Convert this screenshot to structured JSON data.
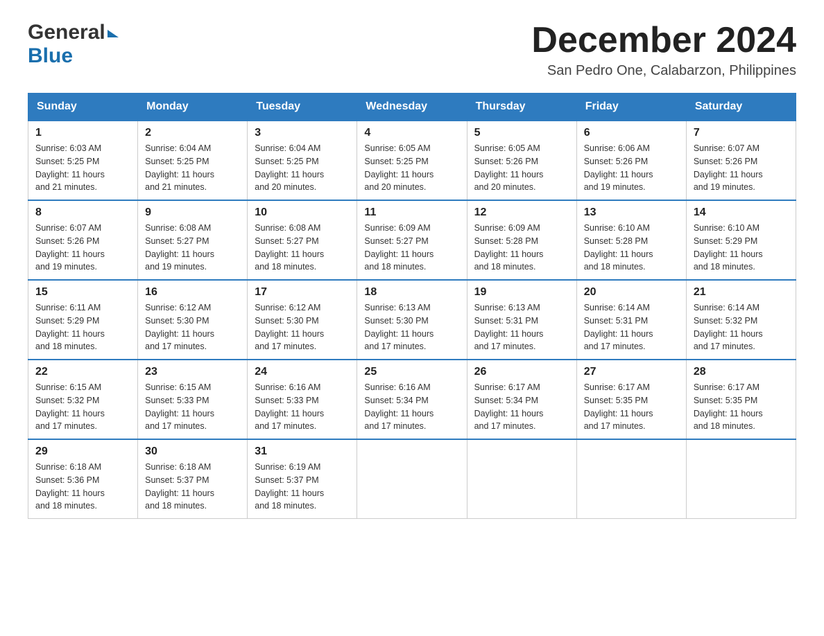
{
  "header": {
    "logo_general": "General",
    "logo_blue": "Blue",
    "month_title": "December 2024",
    "location": "San Pedro One, Calabarzon, Philippines"
  },
  "days_of_week": [
    "Sunday",
    "Monday",
    "Tuesday",
    "Wednesday",
    "Thursday",
    "Friday",
    "Saturday"
  ],
  "weeks": [
    [
      {
        "num": "1",
        "sunrise": "6:03 AM",
        "sunset": "5:25 PM",
        "daylight": "11 hours and 21 minutes."
      },
      {
        "num": "2",
        "sunrise": "6:04 AM",
        "sunset": "5:25 PM",
        "daylight": "11 hours and 21 minutes."
      },
      {
        "num": "3",
        "sunrise": "6:04 AM",
        "sunset": "5:25 PM",
        "daylight": "11 hours and 20 minutes."
      },
      {
        "num": "4",
        "sunrise": "6:05 AM",
        "sunset": "5:25 PM",
        "daylight": "11 hours and 20 minutes."
      },
      {
        "num": "5",
        "sunrise": "6:05 AM",
        "sunset": "5:26 PM",
        "daylight": "11 hours and 20 minutes."
      },
      {
        "num": "6",
        "sunrise": "6:06 AM",
        "sunset": "5:26 PM",
        "daylight": "11 hours and 19 minutes."
      },
      {
        "num": "7",
        "sunrise": "6:07 AM",
        "sunset": "5:26 PM",
        "daylight": "11 hours and 19 minutes."
      }
    ],
    [
      {
        "num": "8",
        "sunrise": "6:07 AM",
        "sunset": "5:26 PM",
        "daylight": "11 hours and 19 minutes."
      },
      {
        "num": "9",
        "sunrise": "6:08 AM",
        "sunset": "5:27 PM",
        "daylight": "11 hours and 19 minutes."
      },
      {
        "num": "10",
        "sunrise": "6:08 AM",
        "sunset": "5:27 PM",
        "daylight": "11 hours and 18 minutes."
      },
      {
        "num": "11",
        "sunrise": "6:09 AM",
        "sunset": "5:27 PM",
        "daylight": "11 hours and 18 minutes."
      },
      {
        "num": "12",
        "sunrise": "6:09 AM",
        "sunset": "5:28 PM",
        "daylight": "11 hours and 18 minutes."
      },
      {
        "num": "13",
        "sunrise": "6:10 AM",
        "sunset": "5:28 PM",
        "daylight": "11 hours and 18 minutes."
      },
      {
        "num": "14",
        "sunrise": "6:10 AM",
        "sunset": "5:29 PM",
        "daylight": "11 hours and 18 minutes."
      }
    ],
    [
      {
        "num": "15",
        "sunrise": "6:11 AM",
        "sunset": "5:29 PM",
        "daylight": "11 hours and 18 minutes."
      },
      {
        "num": "16",
        "sunrise": "6:12 AM",
        "sunset": "5:30 PM",
        "daylight": "11 hours and 17 minutes."
      },
      {
        "num": "17",
        "sunrise": "6:12 AM",
        "sunset": "5:30 PM",
        "daylight": "11 hours and 17 minutes."
      },
      {
        "num": "18",
        "sunrise": "6:13 AM",
        "sunset": "5:30 PM",
        "daylight": "11 hours and 17 minutes."
      },
      {
        "num": "19",
        "sunrise": "6:13 AM",
        "sunset": "5:31 PM",
        "daylight": "11 hours and 17 minutes."
      },
      {
        "num": "20",
        "sunrise": "6:14 AM",
        "sunset": "5:31 PM",
        "daylight": "11 hours and 17 minutes."
      },
      {
        "num": "21",
        "sunrise": "6:14 AM",
        "sunset": "5:32 PM",
        "daylight": "11 hours and 17 minutes."
      }
    ],
    [
      {
        "num": "22",
        "sunrise": "6:15 AM",
        "sunset": "5:32 PM",
        "daylight": "11 hours and 17 minutes."
      },
      {
        "num": "23",
        "sunrise": "6:15 AM",
        "sunset": "5:33 PM",
        "daylight": "11 hours and 17 minutes."
      },
      {
        "num": "24",
        "sunrise": "6:16 AM",
        "sunset": "5:33 PM",
        "daylight": "11 hours and 17 minutes."
      },
      {
        "num": "25",
        "sunrise": "6:16 AM",
        "sunset": "5:34 PM",
        "daylight": "11 hours and 17 minutes."
      },
      {
        "num": "26",
        "sunrise": "6:17 AM",
        "sunset": "5:34 PM",
        "daylight": "11 hours and 17 minutes."
      },
      {
        "num": "27",
        "sunrise": "6:17 AM",
        "sunset": "5:35 PM",
        "daylight": "11 hours and 17 minutes."
      },
      {
        "num": "28",
        "sunrise": "6:17 AM",
        "sunset": "5:35 PM",
        "daylight": "11 hours and 18 minutes."
      }
    ],
    [
      {
        "num": "29",
        "sunrise": "6:18 AM",
        "sunset": "5:36 PM",
        "daylight": "11 hours and 18 minutes."
      },
      {
        "num": "30",
        "sunrise": "6:18 AM",
        "sunset": "5:37 PM",
        "daylight": "11 hours and 18 minutes."
      },
      {
        "num": "31",
        "sunrise": "6:19 AM",
        "sunset": "5:37 PM",
        "daylight": "11 hours and 18 minutes."
      },
      null,
      null,
      null,
      null
    ]
  ],
  "labels": {
    "sunrise": "Sunrise:",
    "sunset": "Sunset:",
    "daylight": "Daylight:"
  }
}
